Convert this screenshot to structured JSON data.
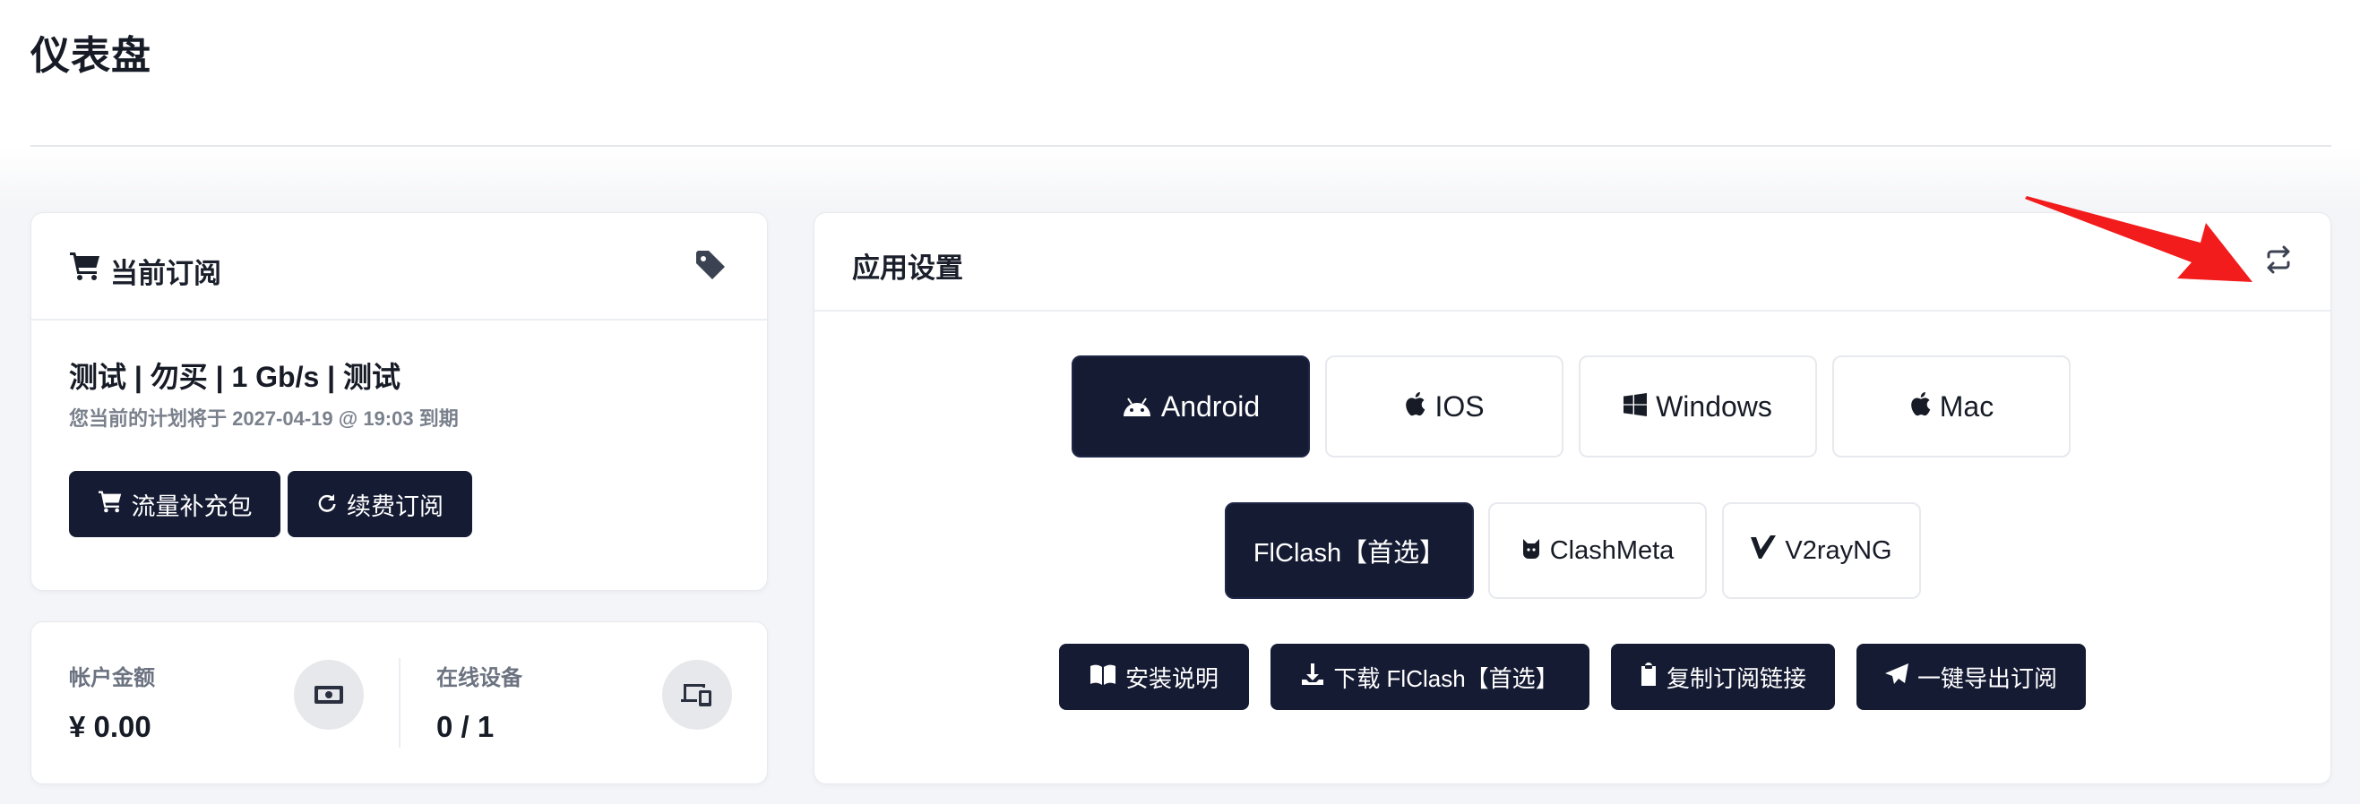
{
  "page": {
    "title": "仪表盘"
  },
  "subscription": {
    "header": "当前订阅",
    "plan_name": "测试 | 勿买 | 1 Gb/s | 测试",
    "expire_text": "您当前的计划将于 2027-04-19 @ 19:03 到期",
    "buttons": {
      "traffic": "流量补充包",
      "renew": "续费订阅"
    }
  },
  "stats": {
    "balance_label": "帐户金额",
    "balance_value": "¥ 0.00",
    "devices_label": "在线设备",
    "devices_value": "0 / 1"
  },
  "app_settings": {
    "header": "应用设置",
    "platforms": [
      {
        "label": "Android",
        "icon": "android-icon",
        "active": true
      },
      {
        "label": "IOS",
        "icon": "apple-icon",
        "active": false
      },
      {
        "label": "Windows",
        "icon": "windows-icon",
        "active": false
      },
      {
        "label": "Mac",
        "icon": "apple-icon",
        "active": false
      }
    ],
    "clients": [
      {
        "label": "FlClash【首选】",
        "icon": "",
        "active": true
      },
      {
        "label": "ClashMeta",
        "icon": "cat-icon",
        "active": false
      },
      {
        "label": "V2rayNG",
        "icon": "v-icon",
        "active": false
      }
    ],
    "actions": {
      "install": "安装说明",
      "download": "下载 FlClash【首选】",
      "copy": "复制订阅链接",
      "export": "一键导出订阅"
    }
  },
  "colors": {
    "primary": "#151b33",
    "arrow": "#f21c1c",
    "background": "#f4f5f8"
  }
}
